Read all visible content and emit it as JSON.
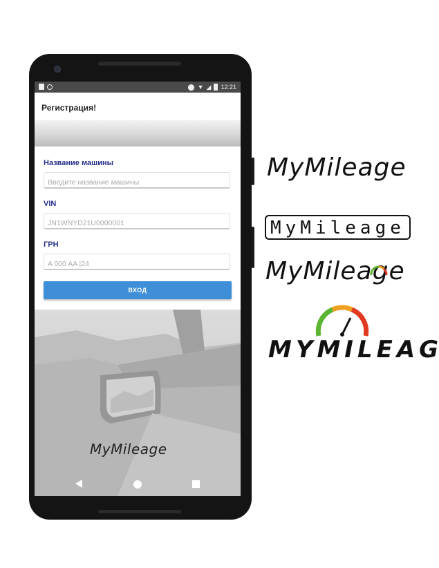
{
  "status_bar": {
    "time": "12:21",
    "icons": [
      "sd-card-icon",
      "sync-icon",
      "location-icon",
      "wifi-icon",
      "signal-icon",
      "battery-icon"
    ]
  },
  "app": {
    "title": "Регистрация!"
  },
  "form": {
    "car_name": {
      "label": "Название машины",
      "placeholder": "Введите название машины"
    },
    "vin": {
      "label": "VIN",
      "placeholder": "JN1WNYD21U0000001"
    },
    "grn": {
      "label": "ГРН",
      "placeholder": "A 000 AA |24"
    },
    "login_button": "ВХОД"
  },
  "watermark": "MyMileage",
  "nav": {
    "back": "back-icon",
    "home": "home-icon",
    "recent": "recent-apps-icon"
  },
  "logos": [
    {
      "variant": "script",
      "text": "MyMileage"
    },
    {
      "variant": "boxed",
      "text": "MyMileage"
    },
    {
      "variant": "script-gauge",
      "text": "MyMileage"
    },
    {
      "variant": "bold-gauge",
      "text": "MYMILEAGE"
    }
  ],
  "colors": {
    "accent_button": "#3e8fd8",
    "label_blue": "#25318a",
    "gauge_green": "#5bb531",
    "gauge_orange": "#f0a020",
    "gauge_red": "#e03a20"
  }
}
